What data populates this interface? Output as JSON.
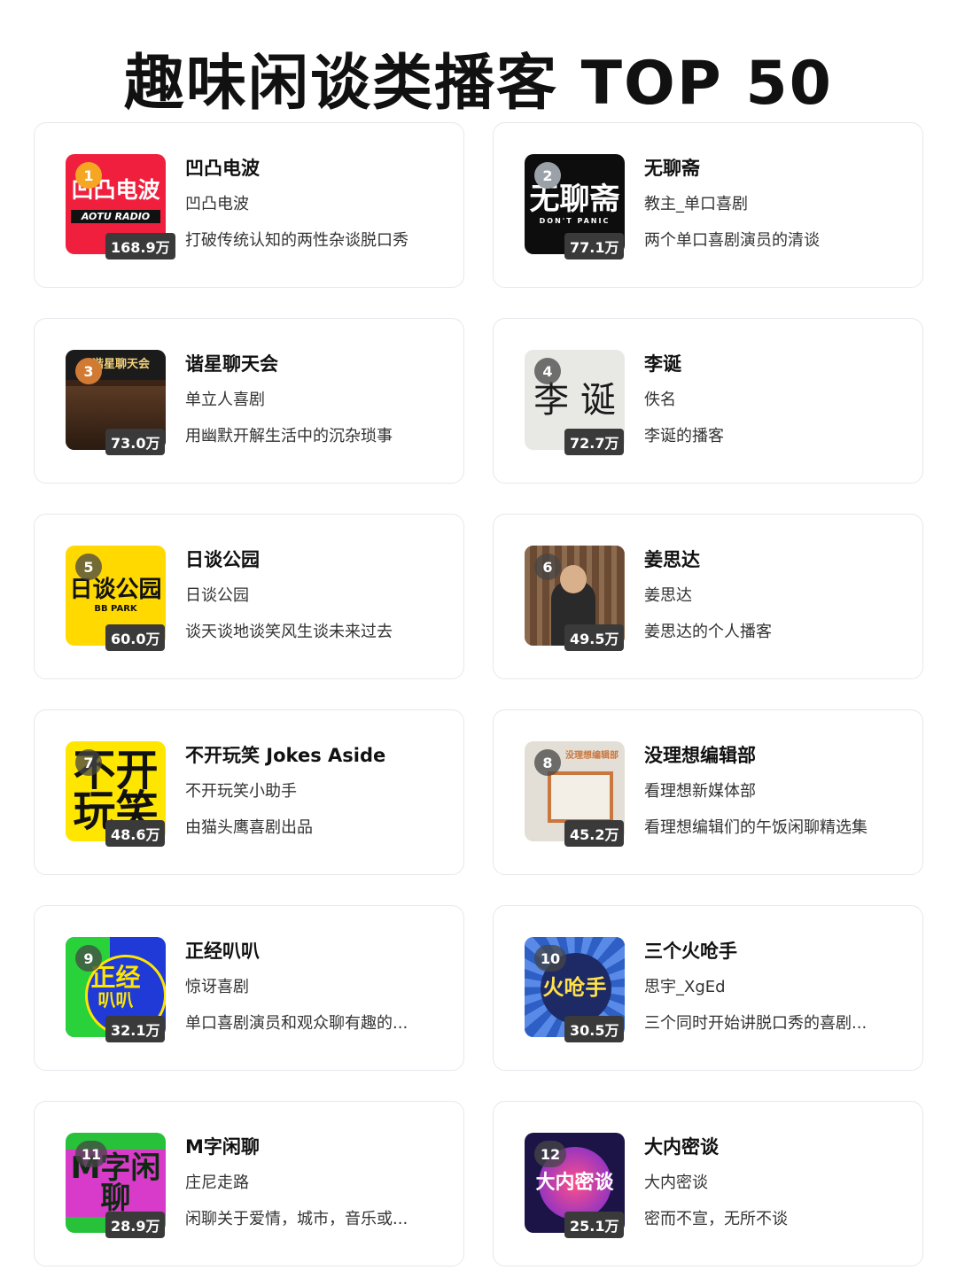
{
  "title": "趣味闲谈类播客 TOP 50",
  "shows": [
    {
      "rank": "1",
      "name": "凹凸电波",
      "author": "凹凸电波",
      "desc": "打破传统认知的两性杂谈脱口秀",
      "plays": "168.9万",
      "cover_text": "凹凸电波",
      "cover_subtext": "AOTU RADIO",
      "cover_bg": "#f01f3d",
      "cover_fg": "#ffffff",
      "rank_style": "gold"
    },
    {
      "rank": "2",
      "name": "无聊斋",
      "author": "教主_单口喜剧",
      "desc": "两个单口喜剧演员的清谈",
      "plays": "77.1万",
      "cover_text": "无聊斋",
      "cover_subtext": "DON'T PANIC",
      "cover_bg": "#0d0d0d",
      "cover_fg": "#ffffff",
      "rank_style": "silver"
    },
    {
      "rank": "3",
      "name": "谐星聊天会",
      "author": "单立人喜剧",
      "desc": "用幽默开解生活中的沉杂琐事",
      "plays": "73.0万",
      "cover_text": "谐星聊天会",
      "cover_subtext": "",
      "cover_bg": "#3a2418",
      "cover_fg": "#f3d27a",
      "rank_style": "bronze"
    },
    {
      "rank": "4",
      "name": "李诞",
      "author": "佚名",
      "desc": "李诞的播客",
      "plays": "72.7万",
      "cover_text": "李 诞",
      "cover_subtext": "",
      "cover_bg": "#e8e8e4",
      "cover_fg": "#1a1a1a",
      "rank_style": "dark"
    },
    {
      "rank": "5",
      "name": "日谈公园",
      "author": "日谈公园",
      "desc": "谈天谈地谈笑风生谈未来过去",
      "plays": "60.0万",
      "cover_text": "日谈公园",
      "cover_subtext": "BB PARK",
      "cover_bg": "#ffd900",
      "cover_fg": "#111111",
      "rank_style": "dark"
    },
    {
      "rank": "6",
      "name": "姜思达",
      "author": "姜思达",
      "desc": "姜思达的个人播客",
      "plays": "49.5万",
      "cover_text": "",
      "cover_subtext": "",
      "cover_bg": "#6b4a33",
      "cover_fg": "#ffffff",
      "rank_style": "dark"
    },
    {
      "rank": "7",
      "name": "不开玩笑 Jokes Aside",
      "author": "不开玩笑小助手",
      "desc": "由猫头鹰喜剧出品",
      "plays": "48.6万",
      "cover_text": "不开玩笑",
      "cover_subtext": "",
      "cover_bg": "#ffe600",
      "cover_fg": "#111111",
      "rank_style": "dark"
    },
    {
      "rank": "8",
      "name": "没理想编辑部",
      "author": "看理想新媒体部",
      "desc": "看理想编辑们的午饭闲聊精选集",
      "plays": "45.2万",
      "cover_text": "没理想编辑部",
      "cover_subtext": "",
      "cover_bg": "#e4dfd6",
      "cover_fg": "#c9773f",
      "rank_style": "dark"
    },
    {
      "rank": "9",
      "name": "正经叭叭",
      "author": "惊讶喜剧",
      "desc": "单口喜剧演员和观众聊有趣的...",
      "plays": "32.1万",
      "cover_text": "正经",
      "cover_subtext": "叭叭",
      "cover_bg": "#1f3ad6",
      "cover_fg": "#ffe600",
      "rank_style": "dark"
    },
    {
      "rank": "10",
      "name": "三个火呛手",
      "author": "思宇_XgEd",
      "desc": "三个同时开始讲脱口秀的喜剧...",
      "plays": "30.5万",
      "cover_text": "火呛手",
      "cover_subtext": "",
      "cover_bg": "#2d5fc4",
      "cover_fg": "#ffe14a",
      "rank_style": "dark"
    },
    {
      "rank": "11",
      "name": "M字闲聊",
      "author": "庄尼走路",
      "desc": "闲聊关于爱情，城市，音乐或...",
      "plays": "28.9万",
      "cover_text": "M字闲聊",
      "cover_subtext": "",
      "cover_bg": "#27c13a",
      "cover_fg": "#0d2a10",
      "rank_style": "dark"
    },
    {
      "rank": "12",
      "name": "大内密谈",
      "author": "大内密谈",
      "desc": "密而不宣，无所不谈",
      "plays": "25.1万",
      "cover_text": "大内密谈",
      "cover_subtext": "",
      "cover_bg": "#1c1446",
      "cover_fg": "#ffffff",
      "rank_style": "dark"
    }
  ]
}
